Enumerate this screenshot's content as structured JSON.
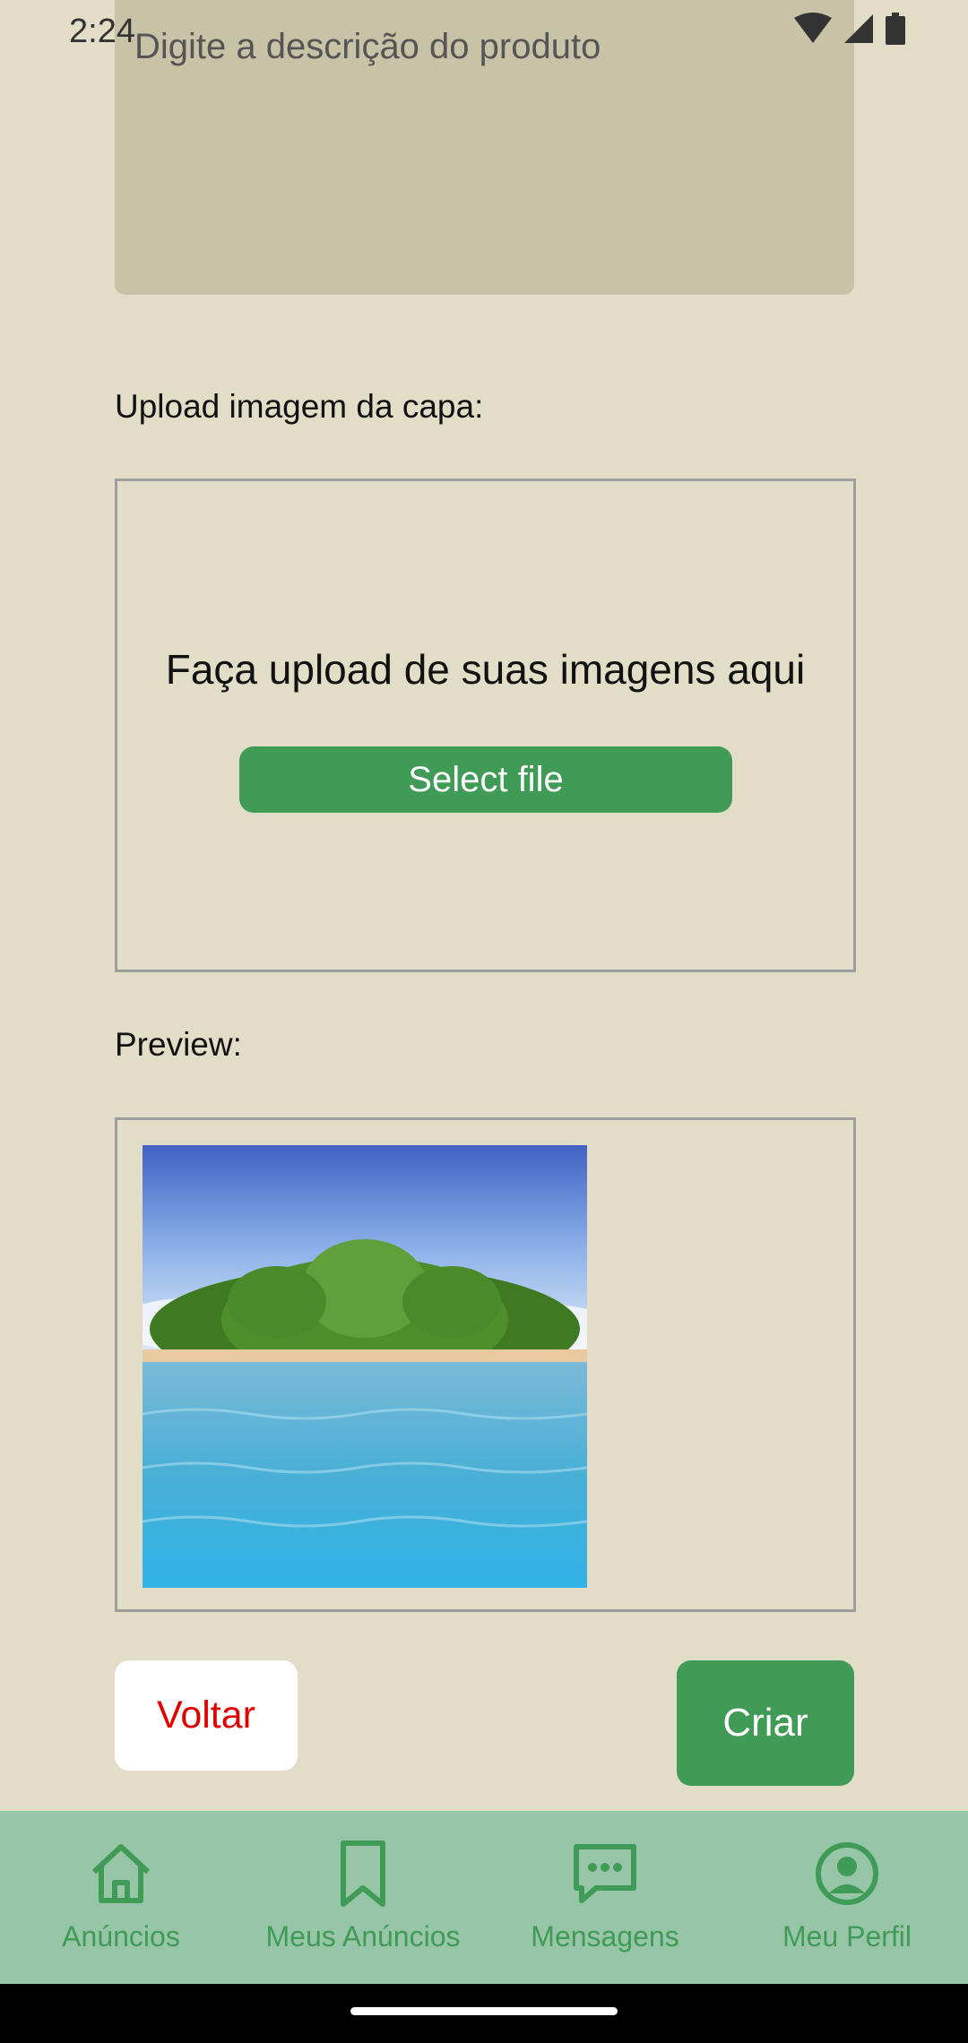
{
  "status_bar": {
    "time": "2:24"
  },
  "description_field": {
    "placeholder": "Digite a descrição do produto"
  },
  "upload_section": {
    "label": "Upload imagem da capa:",
    "dropzone_text": "Faça upload de suas imagens aqui",
    "select_button": "Select file"
  },
  "preview_section": {
    "label": "Preview:"
  },
  "actions": {
    "back": "Voltar",
    "create": "Criar"
  },
  "bottom_nav": {
    "items": [
      {
        "label": "Anúncios",
        "icon": "home-icon"
      },
      {
        "label": "Meus Anúncios",
        "icon": "bookmark-icon"
      },
      {
        "label": "Mensagens",
        "icon": "chat-icon"
      },
      {
        "label": "Meu Perfil",
        "icon": "profile-icon"
      }
    ]
  },
  "colors": {
    "background": "#e1ddc7",
    "accent_green": "#3f9b55",
    "nav_background": "#97c5a7",
    "danger_red": "#e00000"
  }
}
